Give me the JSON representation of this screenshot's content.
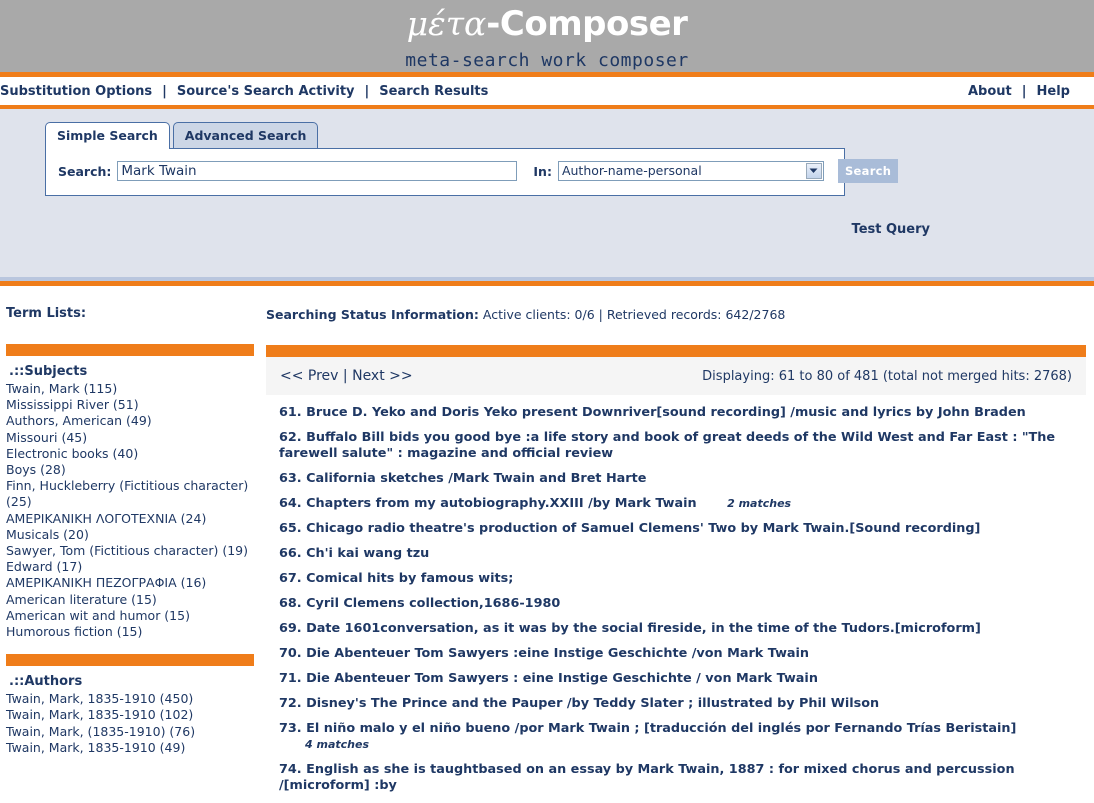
{
  "header": {
    "logo_greek": "μέτα",
    "logo_rest": "-Composer",
    "tagline": "meta-search work composer"
  },
  "nav": {
    "left": [
      "Substitution Options",
      "Source's Search Activity",
      "Search Results"
    ],
    "right": [
      "About",
      "Help"
    ],
    "separator": "|"
  },
  "search": {
    "tabs": [
      {
        "label": "Simple Search",
        "active": true
      },
      {
        "label": "Advanced Search",
        "active": false
      }
    ],
    "search_label": "Search:",
    "query_value": "Mark Twain",
    "query_placeholder": "",
    "in_label": "In:",
    "index_selected": "Author-name-personal",
    "index_options": [
      "Author-name-personal"
    ],
    "search_button": "Search",
    "test_query_label": "Test Query"
  },
  "sidebar": {
    "title": "Term Lists:",
    "groups": [
      {
        "heading": ".::Subjects",
        "terms": [
          "Twain, Mark (115)",
          "Mississippi River (51)",
          "Authors, American (49)",
          "Missouri (45)",
          "Electronic books (40)",
          "Boys (28)",
          "Finn, Huckleberry (Fictitious character) (25)",
          "ΑΜΕΡΙΚΑΝΙΚΗ ΛΟΓΟΤΕΧΝΙΑ (24)",
          "Musicals (20)",
          "Sawyer, Tom (Fictitious character) (19)",
          "Edward (17)",
          "ΑΜΕΡΙΚΑΝΙΚΗ ΠΕΖΟΓΡΑΦΙΑ (16)",
          "American literature (15)",
          "American wit and humor (15)",
          "Humorous fiction (15)"
        ]
      },
      {
        "heading": ".::Authors",
        "terms": [
          "Twain, Mark, 1835-1910 (450)",
          "Twain, Mark, 1835-1910 (102)",
          "Twain, Mark, (1835-1910) (76)",
          "Twain, Mark, 1835-1910 (49)"
        ]
      }
    ]
  },
  "status": {
    "label": "Searching Status Information:",
    "detail": " Active clients: 0/6 | Retrieved records: 642/2768"
  },
  "pager": {
    "prev": "<< Prev",
    "separator": "|",
    "next": "Next >>",
    "displaying": "Displaying: 61 to 80 of 481 (total not merged hits: 2768)"
  },
  "results": [
    {
      "num": "61.",
      "title": "Bruce D. Yeko and Doris Yeko present Downriver[sound recording] /music and lyrics by John Braden",
      "matches": ""
    },
    {
      "num": "62.",
      "title": "Buffalo Bill bids you good bye :a life story and book of great deeds of the Wild West and Far East : \"The farewell salute\" : magazine and official review",
      "matches": ""
    },
    {
      "num": "63.",
      "title": "California sketches /Mark Twain and Bret Harte",
      "matches": ""
    },
    {
      "num": "64.",
      "title": "Chapters from my autobiography.XXIII /by Mark Twain",
      "matches": "2 matches"
    },
    {
      "num": "65.",
      "title": "Chicago radio theatre's production of Samuel Clemens' Two by Mark Twain.[Sound recording]",
      "matches": ""
    },
    {
      "num": "66.",
      "title": "Ch'i kai wang tzu",
      "matches": ""
    },
    {
      "num": "67.",
      "title": "Comical hits by famous wits;",
      "matches": ""
    },
    {
      "num": "68.",
      "title": "Cyril Clemens collection,1686-1980",
      "matches": ""
    },
    {
      "num": "69.",
      "title": "Date 1601conversation, as it was by the social fireside, in the time of the Tudors.[microform]",
      "matches": ""
    },
    {
      "num": "70.",
      "title": "Die Abenteuer Tom Sawyers :eine Instige Geschichte /von Mark Twain",
      "matches": ""
    },
    {
      "num": "71.",
      "title": "Die Abenteuer Tom Sawyers : eine Instige Geschichte / von Mark Twain",
      "matches": ""
    },
    {
      "num": "72.",
      "title": "Disney's The Prince and the Pauper /by Teddy Slater ; illustrated by Phil Wilson",
      "matches": ""
    },
    {
      "num": "73.",
      "title": "El niño malo y el niño bueno /por Mark Twain ; [traducción del inglés por Fernando Trías Beristain]",
      "matches": "4 matches"
    },
    {
      "num": "74.",
      "title": "English as she is taughtbased on an essay by Mark Twain, 1887 : for mixed chorus and percussion /[microform] :by",
      "matches": ""
    }
  ],
  "colors": {
    "accent_orange": "#ef7d1a",
    "header_gray": "#a9a9a9",
    "panel_blue": "#dfe3ec",
    "text_navy": "#1f3864"
  }
}
